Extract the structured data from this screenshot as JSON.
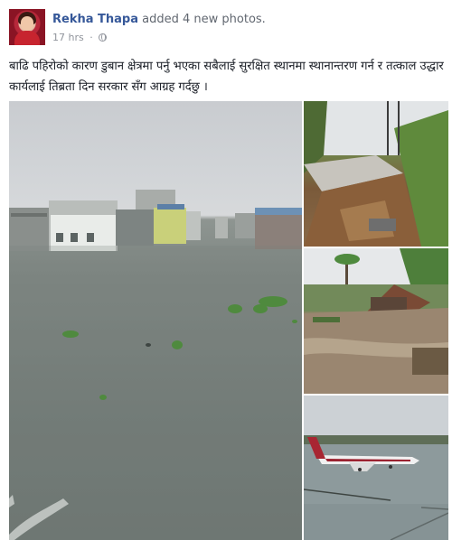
{
  "post": {
    "author_name": "Rekha Thapa",
    "action_text": "added 4 new photos.",
    "timestamp": "17 hrs",
    "separator": "·",
    "privacy_icon": "globe-icon",
    "caption": "बाढि पहिरोको कारण डुबान क्षेत्रमा पर्नु भएका सबैलाई सुरक्षित स्थानमा स्थानान्तरण गर्न र तत्काल उद्धार कार्यलाई तिब्रता दिन सरकार सँग आग्रह गर्दछु ।"
  },
  "photos": {
    "count": 4
  },
  "colors": {
    "author_link": "#365899",
    "meta_text": "#90949c",
    "body_text": "#1d2129"
  }
}
